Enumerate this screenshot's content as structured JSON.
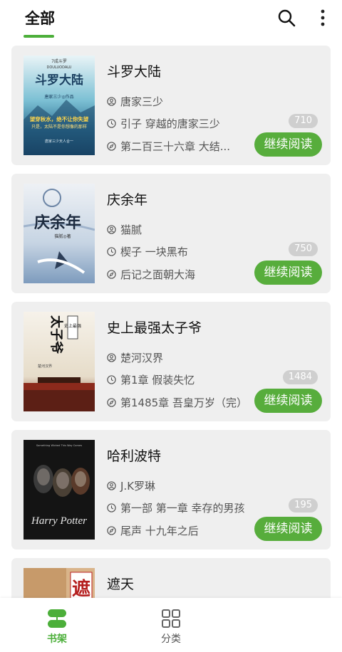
{
  "header": {
    "tab_label": "全部",
    "accent": "#4caf3a"
  },
  "books": [
    {
      "title": "斗罗大陆",
      "author": "唐家三少",
      "progress": "引子 穿越的唐家三少",
      "latest": "第二百三十六章 大结...",
      "count": "710",
      "button": "继续阅读",
      "cover": {
        "top": "7成斗罗",
        "sub": "DOULUODALU",
        "name": "斗罗大陆",
        "author_line": "唐家三少◎作品",
        "slogan1": "望穿秋水，绝不让你失望",
        "slogan2": "只是，太陆不是你想像的那样",
        "slogan3": "唐家三少天人合一"
      }
    },
    {
      "title": "庆余年",
      "author": "猫腻",
      "progress": "楔子 一块黑布",
      "latest": "后记之面朝大海",
      "count": "750",
      "button": "继续阅读",
      "cover": {
        "name": "庆余年",
        "author_line": "猫腻◎著"
      }
    },
    {
      "title": "史上最强太子爷",
      "author": "楚河汉界",
      "progress": "第1章 假装失忆",
      "latest": "第1485章 吾皇万岁（完）",
      "count": "1484",
      "button": "继续阅读",
      "cover": {
        "tag": "史上最强",
        "name": "太子爷",
        "author_line": "楚河汉界"
      }
    },
    {
      "title": "哈利波特",
      "author": "J.K罗琳",
      "progress": "第一部 第一章 幸存的男孩",
      "latest": "尾声 十九年之后",
      "count": "195",
      "button": "继续阅读",
      "cover": {
        "top": "Something Wicked This Way Comes",
        "name": "Harry Potter"
      }
    },
    {
      "title": "遮天",
      "cover": {
        "name": "遮"
      }
    }
  ],
  "nav": {
    "shelf": "书架",
    "category": "分类"
  },
  "icons": {
    "search": "search-icon",
    "more": "more-vertical-icon",
    "author": "person-icon",
    "progress": "clock-icon",
    "latest": "compass-icon",
    "shelf": "bookshelf-icon",
    "category": "grid-icon"
  },
  "colors": {
    "button_green": "#57ad3c",
    "card_bg": "#efefef",
    "badge_bg": "#cfcfcf"
  }
}
